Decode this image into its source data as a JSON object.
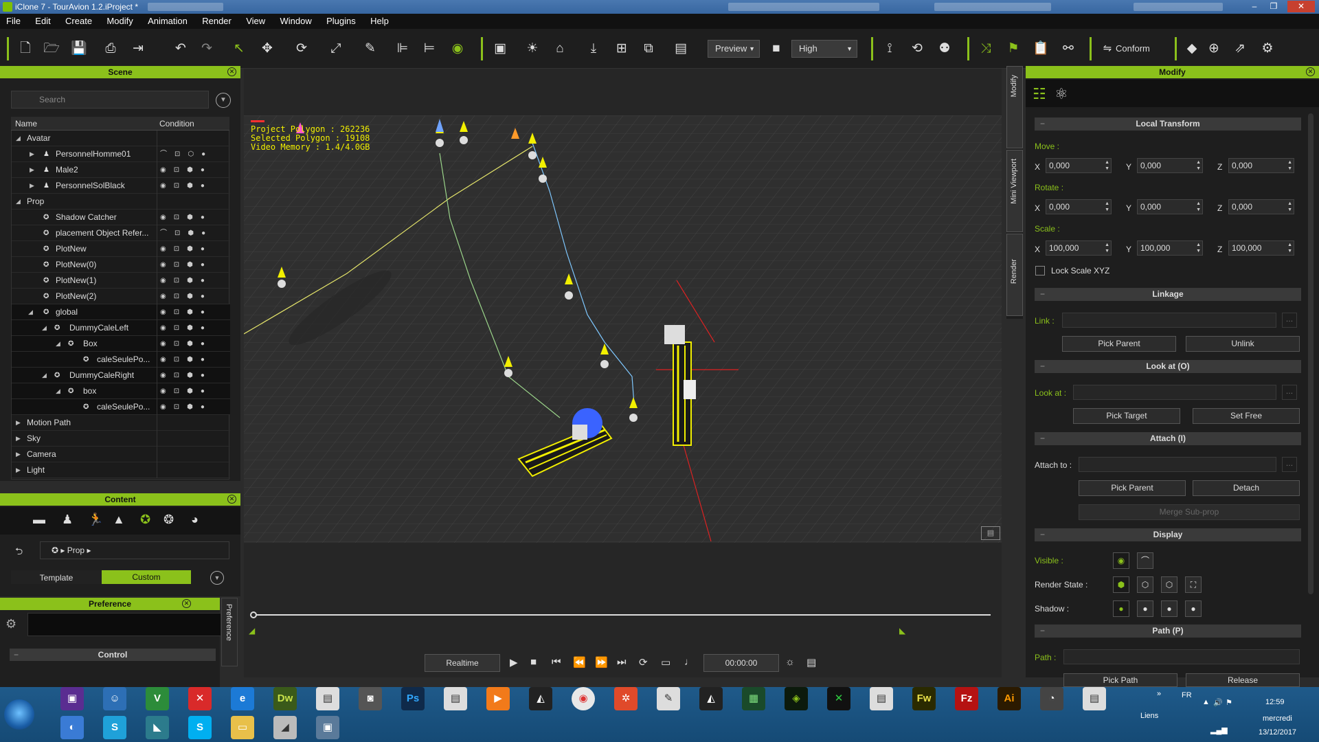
{
  "window": {
    "title": "iClone 7 - TourAvion 1.2.iProject *",
    "controls": [
      "–",
      "❐",
      "✕"
    ]
  },
  "menu": [
    "File",
    "Edit",
    "Create",
    "Modify",
    "Animation",
    "Render",
    "View",
    "Window",
    "Plugins",
    "Help"
  ],
  "toolbar": {
    "quality_preview": "Preview",
    "quality_level": "High",
    "conform_label": "Conform"
  },
  "scene_panel": {
    "title": "Scene",
    "search_placeholder": "Search",
    "col_name": "Name",
    "col_condition": "Condition",
    "rows": [
      {
        "label": "Avatar"
      },
      {
        "label": "PersonnelHomme01"
      },
      {
        "label": "Male2"
      },
      {
        "label": "PersonnelSolBlack"
      },
      {
        "label": "Prop"
      },
      {
        "label": "Shadow Catcher"
      },
      {
        "label": "placement Object Refer..."
      },
      {
        "label": "PlotNew"
      },
      {
        "label": "PlotNew(0)"
      },
      {
        "label": "PlotNew(1)"
      },
      {
        "label": "PlotNew(2)"
      },
      {
        "label": "global"
      },
      {
        "label": "DummyCaleLeft"
      },
      {
        "label": "Box"
      },
      {
        "label": "caleSeulePo..."
      },
      {
        "label": "DummyCaleRight"
      },
      {
        "label": "box"
      },
      {
        "label": "caleSeulePo..."
      },
      {
        "label": "Motion Path"
      },
      {
        "label": "Sky"
      },
      {
        "label": "Camera"
      },
      {
        "label": "Light"
      }
    ]
  },
  "content_panel": {
    "title": "Content",
    "path": "Prop",
    "tab_template": "Template",
    "tab_custom": "Custom"
  },
  "preference_panel": {
    "title": "Preference",
    "side_tab": "Preference",
    "control_label": "Control"
  },
  "viewport": {
    "stats_line1": "Project Polygon : 262236",
    "stats_line2": "Selected Polygon : 19108",
    "stats_line3": "Video Memory : 1.4/4.0GB"
  },
  "side_tabs": [
    "Modify",
    "Mini Viewport",
    "Render"
  ],
  "playback": {
    "mode": "Realtime",
    "timecode": "00:00:00"
  },
  "modify_panel": {
    "title": "Modify",
    "local_transform": "Local Transform",
    "move_label": "Move :",
    "rotate_label": "Rotate :",
    "scale_label": "Scale :",
    "move": {
      "x": "0,000",
      "y": "0,000",
      "z": "0,000"
    },
    "rotate": {
      "x": "0,000",
      "y": "0,000",
      "z": "0,000"
    },
    "scale": {
      "x": "100,000",
      "y": "100,000",
      "z": "100,000"
    },
    "axis_x": "X",
    "axis_y": "Y",
    "axis_z": "Z",
    "lock_scale": "Lock Scale XYZ",
    "linkage": "Linkage",
    "link_label": "Link :",
    "pick_parent": "Pick Parent",
    "unlink": "Unlink",
    "look_at_section": "Look at (O)",
    "look_at_label": "Look at :",
    "pick_target": "Pick Target",
    "set_free": "Set Free",
    "attach_section": "Attach (I)",
    "attach_label": "Attach to :",
    "attach_pick_parent": "Pick Parent",
    "detach": "Detach",
    "merge_subprop": "Merge Sub-prop",
    "display_section": "Display",
    "visible_label": "Visible :",
    "render_state_label": "Render State :",
    "shadow_label": "Shadow :",
    "path_section": "Path (P)",
    "path_label": "Path :",
    "pick_path": "Pick Path",
    "release": "Release"
  },
  "taskbar": {
    "liens": "Liens",
    "lang": "FR",
    "time": "12:59",
    "day": "mercredi",
    "date": "13/12/2017",
    "apps": [
      "Dw",
      "Ps",
      "Fw",
      "Ai",
      "Fz"
    ]
  },
  "colors": {
    "accent_green": "#8bc11b",
    "stats_yellow": "#f2ef00",
    "panel_bg": "#1e1e1e"
  }
}
